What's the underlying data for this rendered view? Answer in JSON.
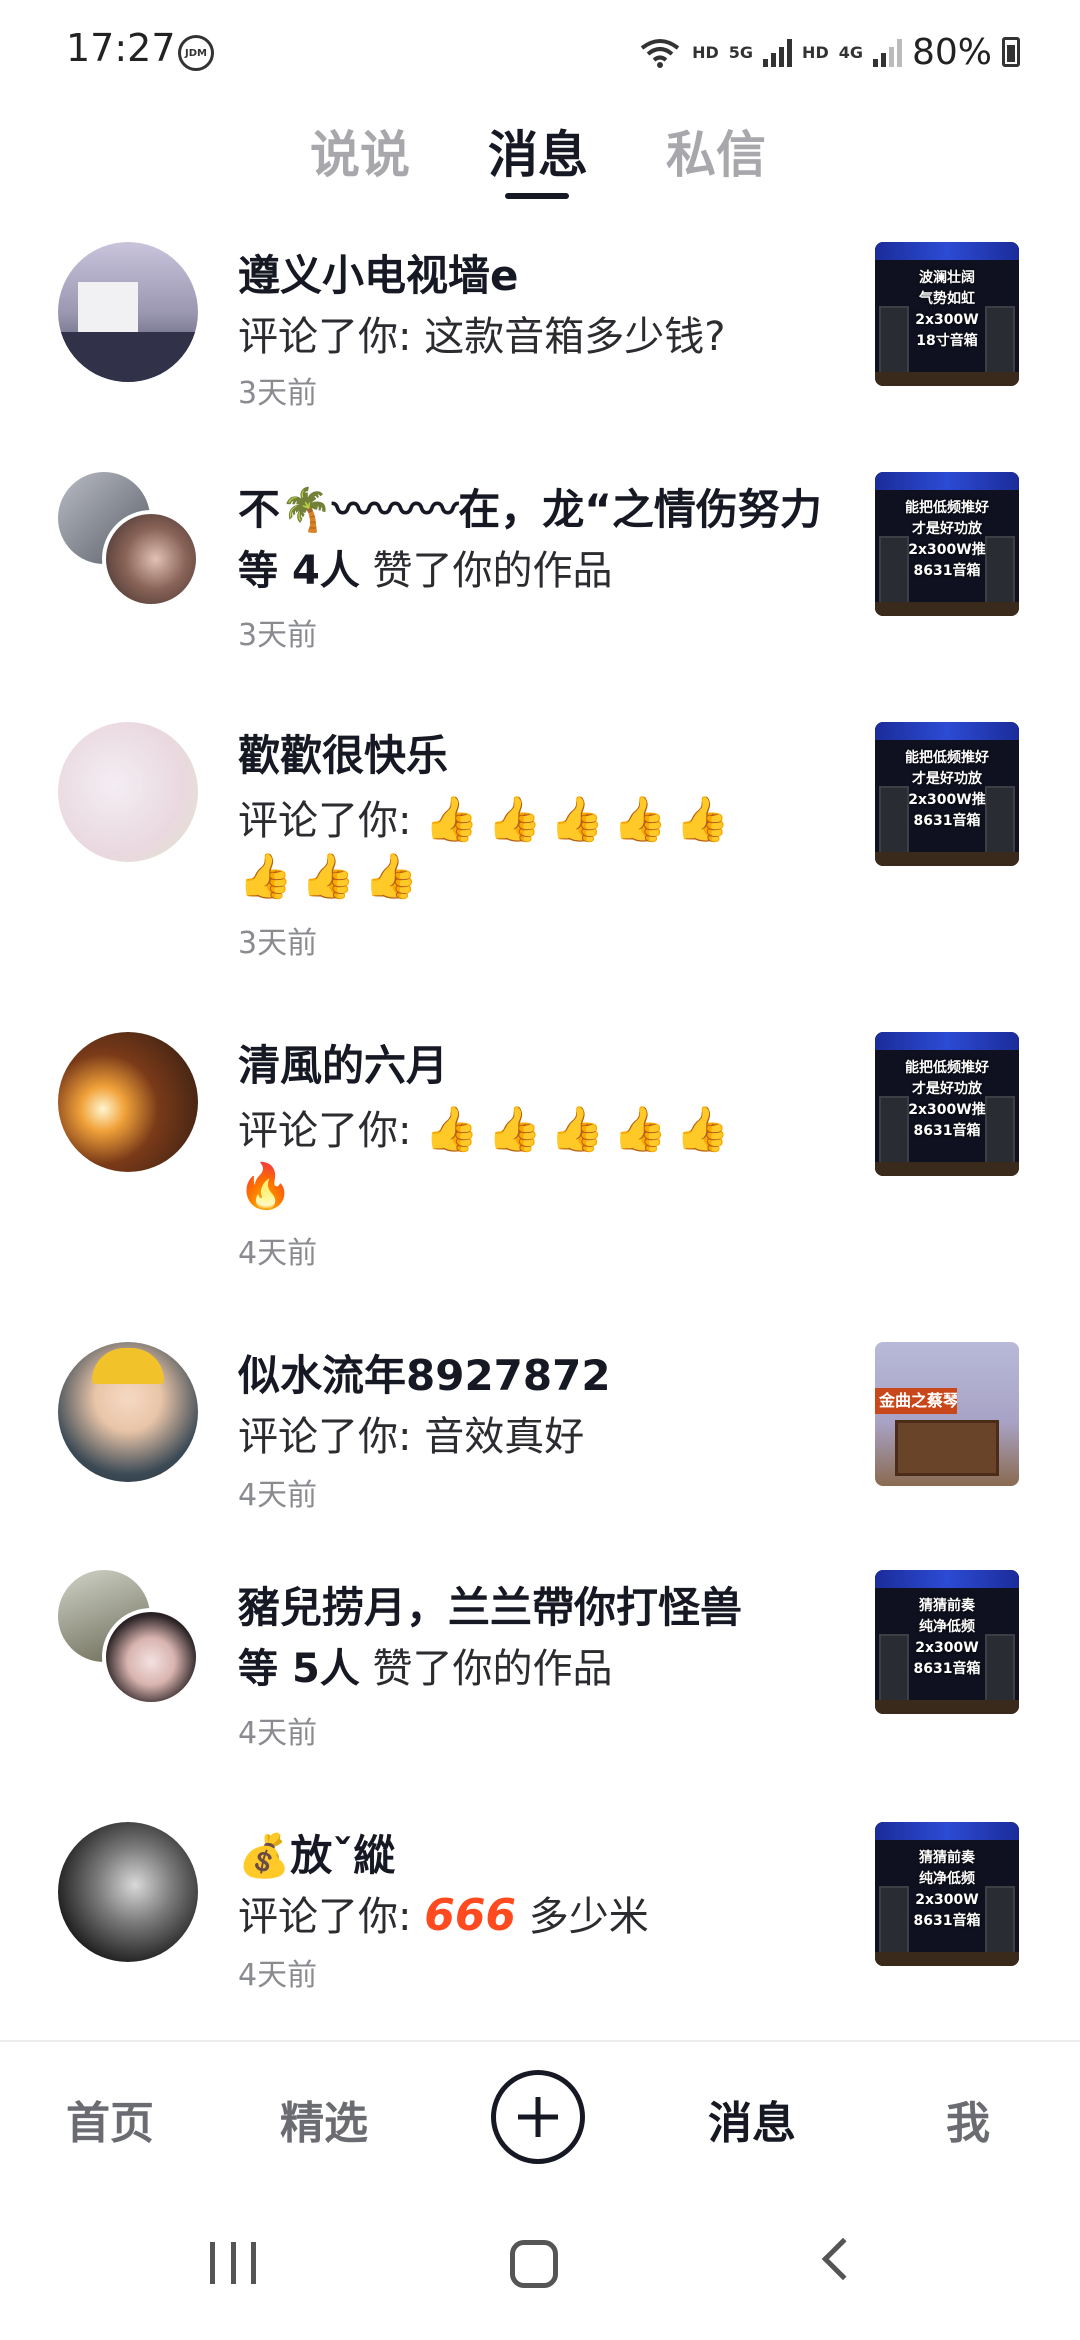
{
  "status_bar": {
    "time": "17:27",
    "badge": "JDM",
    "hd1": "HD",
    "net1": "5G",
    "hd2": "HD",
    "net2": "4G",
    "battery": "80%"
  },
  "tabs": [
    {
      "label": "说说"
    },
    {
      "label": "消息"
    },
    {
      "label": "私信"
    }
  ],
  "messages": [
    {
      "name": "遵义小电视墙e",
      "action": "评论了你: 这款音箱多少钱?",
      "time": "3天前",
      "thumb_text": [
        "波澜壮阔",
        "气势如虹",
        "2x300W",
        "18寸音箱"
      ]
    },
    {
      "name": "不🌴〰〰〰在，龙“之情伤努力",
      "count_prefix": "等 ",
      "count": "4人",
      "action": "赞了你的作品",
      "time": "3天前",
      "thumb_text": [
        "能把低频推好",
        "才是好功放",
        "2x300W推",
        "8631音箱"
      ]
    },
    {
      "name": "歡歡很快乐",
      "action": "评论了你: ",
      "emoji_line1": "👍👍👍👍👍",
      "emoji_line2": "👍👍👍",
      "time": "3天前",
      "thumb_text": [
        "能把低频推好",
        "才是好功放",
        "2x300W推",
        "8631音箱"
      ]
    },
    {
      "name": "清風的六月",
      "action": "评论了你: ",
      "emoji_line1": "👍👍👍👍👍",
      "emoji_line2": "🔥",
      "time": "4天前",
      "thumb_text": [
        "能把低频推好",
        "才是好功放",
        "2x300W推",
        "8631音箱"
      ]
    },
    {
      "name": "似水流年8927872",
      "action": "评论了你: 音效真好",
      "time": "4天前",
      "thumb_label": "金曲之蔡琴"
    },
    {
      "name": "豬兒捞月，兰兰帶你打怪兽",
      "count_prefix": "等 ",
      "count": "5人",
      "action": "赞了你的作品",
      "time": "4天前",
      "thumb_text": [
        "猜猜前奏",
        "纯净低频",
        "2x300W",
        "8631音箱"
      ]
    },
    {
      "name": "💰放ˇ縱",
      "action": "评论了你: ",
      "action_emoji": "666",
      "action_tail": " 多少米",
      "time": "4天前",
      "thumb_text": [
        "猜猜前奏",
        "纯净低频",
        "2x300W",
        "8631音箱"
      ]
    }
  ],
  "bottom_nav": [
    {
      "label": "首页"
    },
    {
      "label": "精选"
    },
    {
      "label": "消息"
    },
    {
      "label": "我"
    }
  ]
}
